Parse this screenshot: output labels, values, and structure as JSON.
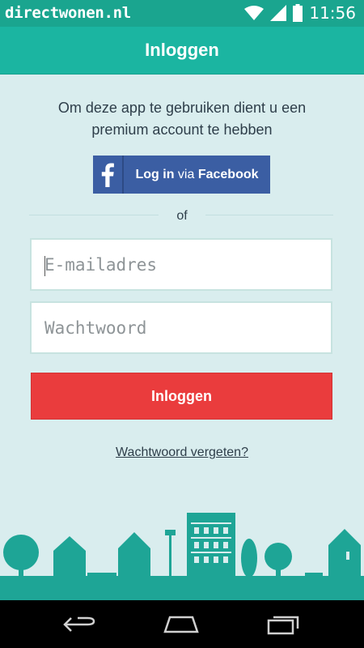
{
  "status_bar": {
    "app_name": "directwonen.nl",
    "time": "11:56",
    "icons": [
      "wifi-icon",
      "signal-icon",
      "battery-icon"
    ]
  },
  "app_bar": {
    "title": "Inloggen"
  },
  "intro": {
    "line1": "Om deze app te gebruiken dient u een",
    "line2": "premium account te hebben"
  },
  "facebook_button": {
    "icon": "facebook-icon",
    "label_prefix": "Log in",
    "label_middle": "via",
    "label_suffix": "Facebook"
  },
  "divider_text": "of",
  "form": {
    "email_placeholder": "E-mailadres",
    "email_value": "",
    "password_placeholder": "Wachtwoord",
    "password_value": ""
  },
  "login_button_label": "Inloggen",
  "forgot_password_link": "Wachtwoord vergeten?",
  "nav_bar": {
    "icons": [
      "back-icon",
      "home-icon",
      "recent-apps-icon"
    ]
  },
  "colors": {
    "status_bar": "#1aa58f",
    "app_bar": "#1bb5a1",
    "background": "#d9edee",
    "facebook": "#3b5ea3",
    "login_button": "#ea3c3d",
    "skyline": "#1ea596"
  }
}
